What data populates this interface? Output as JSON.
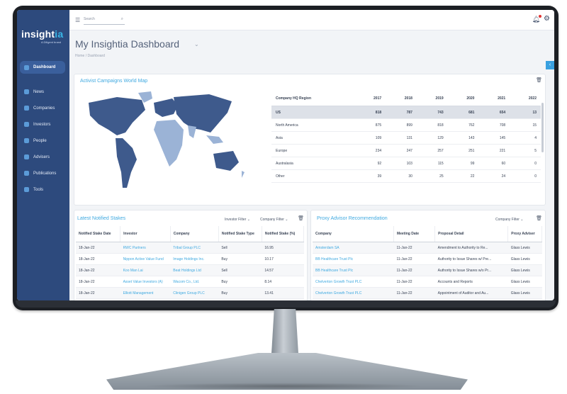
{
  "app": {
    "logo_main": "insight",
    "logo_accent": "ia",
    "logo_sub": "A Diligent brand"
  },
  "sidebar": {
    "items": [
      {
        "label": "Dashboard",
        "icon": "dashboard-icon",
        "active": true
      },
      {
        "label": "News",
        "icon": "news-icon"
      },
      {
        "label": "Companies",
        "icon": "companies-icon"
      },
      {
        "label": "Investors",
        "icon": "investors-icon"
      },
      {
        "label": "People",
        "icon": "people-icon"
      },
      {
        "label": "Advisers",
        "icon": "advisers-icon"
      },
      {
        "label": "Publications",
        "icon": "publications-icon"
      },
      {
        "label": "Tools",
        "icon": "tools-icon"
      }
    ]
  },
  "topbar": {
    "search_placeholder": "Search"
  },
  "page": {
    "title": "My Insightia Dashboard",
    "breadcrumb": "Home  /  Dashboard"
  },
  "map_panel": {
    "title": "Activist Campaigns World Map",
    "table": {
      "header": [
        "Company HQ Region",
        "2017",
        "2018",
        "2019",
        "2020",
        "2021",
        "2022"
      ],
      "rows": [
        [
          "US",
          "818",
          "787",
          "743",
          "681",
          "654",
          "13"
        ],
        [
          "North America",
          "875",
          "899",
          "818",
          "762",
          "708",
          "15"
        ],
        [
          "Asia",
          "109",
          "131",
          "129",
          "143",
          "145",
          "4"
        ],
        [
          "Europe",
          "234",
          "247",
          "257",
          "251",
          "221",
          "5"
        ],
        [
          "Australasia",
          "92",
          "103",
          "115",
          "99",
          "60",
          "0"
        ],
        [
          "Other",
          "39",
          "30",
          "25",
          "22",
          "24",
          "0"
        ]
      ]
    }
  },
  "stakes_panel": {
    "title": "Latest Notified Stakes",
    "investor_filter": "Investor Filter",
    "company_filter": "Company Filter",
    "columns": [
      "Notified Stake Date",
      "Investor",
      "Company",
      "Notified Stake Type",
      "Notified Stake (%)"
    ],
    "rows": [
      [
        "18-Jan-22",
        "RWC Partners",
        "Tribal Group PLC",
        "Sell",
        "16.95"
      ],
      [
        "18-Jan-22",
        "Nippon Active Value Fund",
        "Image Holdings Inc.",
        "Buy",
        "10.17"
      ],
      [
        "18-Jan-22",
        "Koo Man Lai",
        "Beat Holdings Ltd",
        "Sell",
        "14.57"
      ],
      [
        "18-Jan-22",
        "Asset Value Investors (A)",
        "Wacom Co., Ltd.",
        "Buy",
        "8.14"
      ],
      [
        "18-Jan-22",
        "Elliott Management",
        "Clinigen Group PLC",
        "Buy",
        "13.41"
      ]
    ]
  },
  "proxy_panel": {
    "title": "Proxy Advisor Recommendation",
    "company_filter": "Company Filter",
    "columns": [
      "Company",
      "Meeting Date",
      "Proposal Detail",
      "Proxy Adviser"
    ],
    "rows": [
      [
        "Amsterdam SA",
        "11-Jan-22",
        "Amendment to Authority to Re...",
        "Glass Lewis"
      ],
      [
        "BB Healthcare Trust Plc",
        "11-Jan-22",
        "Authority to Issue Shares w/ Pre...",
        "Glass Lewis"
      ],
      [
        "BB Healthcare Trust Plc",
        "11-Jan-22",
        "Authority to Issue Shares w/o Pr...",
        "Glass Lewis"
      ],
      [
        "Chelverton Growth Trust PLC",
        "11-Jan-22",
        "Accounts and Reports",
        "Glass Lewis"
      ],
      [
        "Chelverton Growth Trust PLC",
        "11-Jan-22",
        "Appointment of Auditor and Au...",
        "Glass Lewis"
      ]
    ]
  },
  "colors": {
    "sidebar": "#2d4a7d",
    "accent": "#3fa9e0",
    "map_dark": "#3e5a8c",
    "map_light": "#9bb3d6"
  }
}
